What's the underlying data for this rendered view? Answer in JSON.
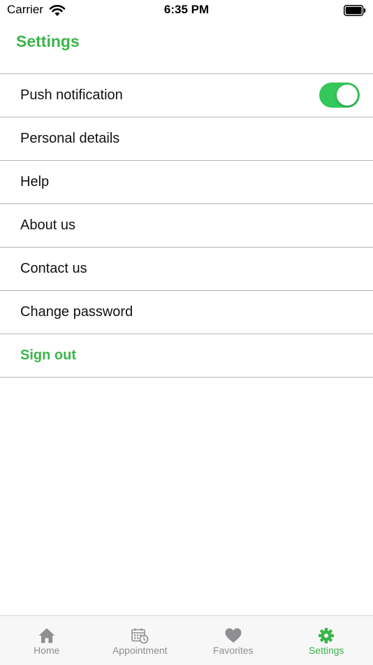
{
  "status_bar": {
    "carrier": "Carrier",
    "time": "6:35 PM"
  },
  "header": {
    "title": "Settings"
  },
  "colors": {
    "accent": "#3bb54a",
    "toggle_on": "#34c759",
    "inactive": "#8e8e93"
  },
  "settings": {
    "items": [
      {
        "label": "Push notification",
        "toggle": true
      },
      {
        "label": "Personal details"
      },
      {
        "label": "Help"
      },
      {
        "label": "About us"
      },
      {
        "label": "Contact us"
      },
      {
        "label": "Change password"
      },
      {
        "label": "Sign out"
      }
    ]
  },
  "tab_bar": {
    "tabs": [
      {
        "label": "Home",
        "icon": "home-icon"
      },
      {
        "label": "Appointment",
        "icon": "calendar-clock-icon"
      },
      {
        "label": "Favorites",
        "icon": "heart-icon"
      },
      {
        "label": "Settings",
        "icon": "gear-icon",
        "active": true
      }
    ]
  }
}
